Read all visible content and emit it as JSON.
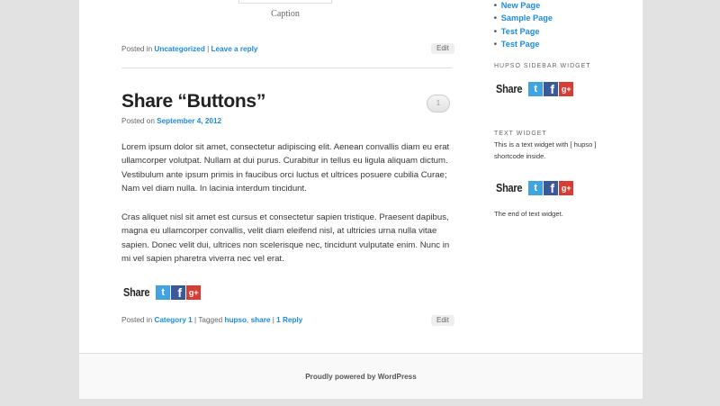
{
  "caption": "Caption",
  "post1_meta": {
    "posted_in_prefix": "Posted in",
    "category": "Uncategorized",
    "separator": "|",
    "comment_link": "Leave a reply",
    "edit": "Edit"
  },
  "post2": {
    "title": "Share “Buttons”",
    "comment_count": "1",
    "posted_on_prefix": "Posted on",
    "date": "September 4, 2012",
    "paragraphs": [
      "Lorem ipsum dolor sit amet, consectetur adipiscing elit. Aenean convallis diam eu erat ullamcorper volutpat. Nullam at dui purus. Curabitur in tellus eu ligula aliquam dictum. Vestibulum ante ipsum primis in faucibus orci luctus et ultrices posuere cubilia Curae; Nam vel diam nulla. In lacinia interdum tincidunt.",
      "Cras aliquet nisl sit amet est cursus et consectetur sapien tristique. Praesent dapibus, magna eu ullamcorper convallis, velit diam eleifend nisl, at ultricies urna nulla vitae sapien. Donec velit dui, ultrices non scelerisque nec, tincidunt vulputate enim. Nunc in mi vel sapien pharetra viverra nec vel erat."
    ],
    "share_label": "Share",
    "footer": {
      "posted_in_prefix": "Posted in",
      "category": "Category 1",
      "separator": "|",
      "tagged_prefix": "Tagged",
      "tag1": "hupso",
      "tag_comma": ",",
      "tag2": "share",
      "separator2": "|",
      "replies": "1 Reply",
      "edit": "Edit"
    }
  },
  "sidebar": {
    "pages": [
      "New Page",
      "Sample Page",
      "Test Page",
      "Test Page"
    ],
    "hupso_widget_title": "HUPSO SIDEBAR WIDGET",
    "hupso_share_label": "Share",
    "text_widget_title": "TEXT WIDGET",
    "text_widget_body": "This is a text widget with [ hupso ] shortcode inside.",
    "text_widget_share_label": "Share",
    "text_widget_end": "The end of text widget."
  },
  "share_icons": {
    "twitter": {
      "glyph": "t",
      "icon": "twitter-bird"
    },
    "facebook": {
      "glyph": "f",
      "icon": "facebook-f"
    },
    "googleplus": {
      "glyph": "g+",
      "icon": "google-plus"
    }
  },
  "colors": {
    "link": "#1b8be0",
    "twitter": "#3fa4e1",
    "facebook": "#3b5998",
    "googleplus": "#d73d32"
  },
  "site_footer": "Proudly powered by WordPress"
}
